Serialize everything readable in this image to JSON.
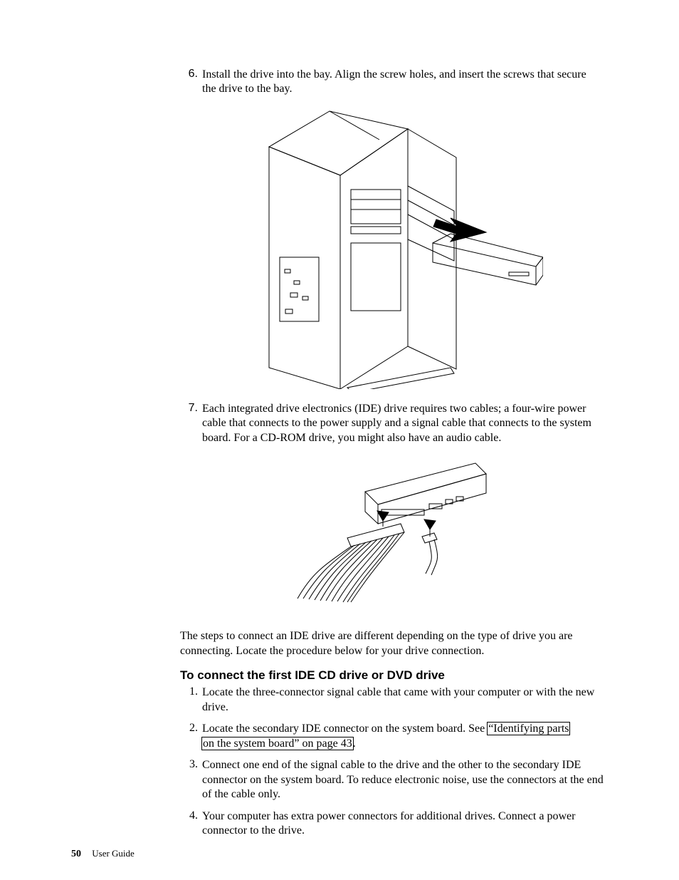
{
  "steps_top": [
    {
      "n": "6.",
      "text": "Install the drive into the bay. Align the screw holes, and insert the screws that secure the drive to the bay."
    },
    {
      "n": "7.",
      "text": "Each integrated drive electronics (IDE) drive requires two cables; a four-wire power cable that connects to the power supply and a signal cable that connects to the system board. For a CD-ROM drive, you might also have an audio cable."
    }
  ],
  "mid_paragraph": "The steps to connect an IDE drive are different depending on the type of drive you are connecting. Locate the procedure below for your drive connection.",
  "subhead": "To connect the first IDE CD drive or DVD drive",
  "steps_sub": [
    {
      "n": "1.",
      "text": "Locate the three-connector signal cable that came with your computer or with the new drive."
    },
    {
      "n": "2.",
      "text_before": "Locate the secondary IDE connector on the system board. See ",
      "link_a": "“Identifying parts",
      "link_b": "on the system board” on page 43",
      "text_after": "."
    },
    {
      "n": "3.",
      "text": "Connect one end of the signal cable to the drive and the other to the secondary IDE connector on the system board. To reduce electronic noise, use the connectors at the end of the cable only."
    },
    {
      "n": "4.",
      "text": "Your computer has extra power connectors for additional drives. Connect a power connector to the drive."
    }
  ],
  "footer_page": "50",
  "footer_label": "User Guide"
}
